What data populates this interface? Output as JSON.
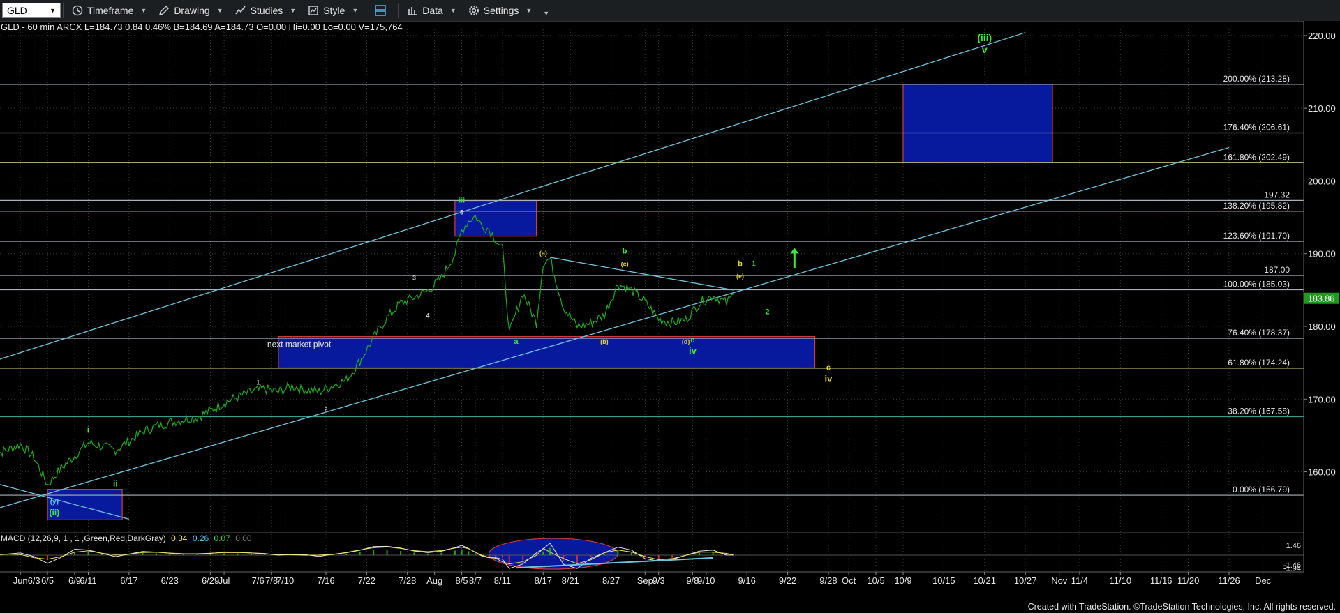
{
  "toolbar": {
    "symbol": "GLD",
    "timeframe": "Timeframe",
    "drawing": "Drawing",
    "studies": "Studies",
    "style": "Style",
    "data": "Data",
    "settings": "Settings"
  },
  "status_line": "GLD - 60 min  ARCX  L=184.73  0.84  0.46%  B=184.69  A=184.73  O=0.00  Hi=0.00  Lo=0.00  V=175,764",
  "macd_legend": {
    "name": "MACD (12,26,9, 1 , 1 ,Green,Red,DarkGray)",
    "v1": "0.34",
    "v2": "0.26",
    "v3": "0.07",
    "v4": "0.00",
    "c1": "#f0e060",
    "c2": "#5ec8ff",
    "c3": "#33dd44",
    "c4": "#777777"
  },
  "footer": "Created with TradeStation. ©TradeStation Technologies, Inc. All rights reserved.",
  "colors": {
    "background": "#000000",
    "grid": "#3a3a3a",
    "price": "#1faa1f",
    "channel": "#6fc4dc",
    "fib_line": "#a9b2bc",
    "box_fill": "#071a9e",
    "box_border": "#d23a3a",
    "wave_green": "#3ee83e",
    "wave_yellow": "#e2cf3a",
    "last_price": "#1f9a1f"
  },
  "chart_data": {
    "type": "line",
    "ylim": [
      152,
      222
    ],
    "y_ticks": [
      160,
      170,
      180,
      190,
      200,
      210,
      220
    ],
    "y_tick_labels": [
      "160.00",
      "170.00",
      "180.00",
      "190.00",
      "200.00",
      "210.00",
      "220.00"
    ],
    "x_tick_labels": [
      "Jun",
      "6/3",
      "6/5",
      "6/9",
      "6/11",
      "6/17",
      "6/23",
      "6/29",
      "Jul",
      "7/6",
      "7/8",
      "7/10",
      "7/16",
      "7/22",
      "7/28",
      "Aug",
      "8/5",
      "8/7",
      "8/11",
      "8/17",
      "8/21",
      "8/27",
      "Sep",
      "9/3",
      "9/8",
      "9/10",
      "9/16",
      "9/22",
      "9/28",
      "Oct",
      "10/5",
      "10/9",
      "10/15",
      "10/21",
      "10/27",
      "Nov",
      "11/4",
      "11/10",
      "11/16",
      "11/20",
      "11/26",
      "Dec"
    ],
    "x_tick_dates": [
      "2024-06-01",
      "2024-06-03",
      "2024-06-05",
      "2024-06-09",
      "2024-06-11",
      "2024-06-17",
      "2024-06-23",
      "2024-06-29",
      "2024-07-01",
      "2024-07-06",
      "2024-07-08",
      "2024-07-10",
      "2024-07-16",
      "2024-07-22",
      "2024-07-28",
      "2024-08-01",
      "2024-08-05",
      "2024-08-07",
      "2024-08-11",
      "2024-08-17",
      "2024-08-21",
      "2024-08-27",
      "2024-09-01",
      "2024-09-03",
      "2024-09-08",
      "2024-09-10",
      "2024-09-16",
      "2024-09-22",
      "2024-09-28",
      "2024-10-01",
      "2024-10-05",
      "2024-10-09",
      "2024-10-15",
      "2024-10-21",
      "2024-10-27",
      "2024-11-01",
      "2024-11-04",
      "2024-11-10",
      "2024-11-16",
      "2024-11-20",
      "2024-11-26",
      "2024-12-01"
    ],
    "last_price": "183.86",
    "last_value": 183.86,
    "price_series": {
      "x": [
        "2024-05-28",
        "2024-05-30",
        "2024-06-01",
        "2024-06-03",
        "2024-06-05",
        "2024-06-07",
        "2024-06-09",
        "2024-06-11",
        "2024-06-13",
        "2024-06-15",
        "2024-06-17",
        "2024-06-19",
        "2024-06-21",
        "2024-06-23",
        "2024-06-25",
        "2024-06-27",
        "2024-06-29",
        "2024-07-01",
        "2024-07-03",
        "2024-07-05",
        "2024-07-07",
        "2024-07-09",
        "2024-07-11",
        "2024-07-13",
        "2024-07-15",
        "2024-07-17",
        "2024-07-19",
        "2024-07-21",
        "2024-07-23",
        "2024-07-25",
        "2024-07-27",
        "2024-07-29",
        "2024-07-31",
        "2024-08-02",
        "2024-08-04",
        "2024-08-05",
        "2024-08-06",
        "2024-08-07",
        "2024-08-08",
        "2024-08-09",
        "2024-08-10",
        "2024-08-11",
        "2024-08-12",
        "2024-08-14",
        "2024-08-16",
        "2024-08-17",
        "2024-08-18",
        "2024-08-20",
        "2024-08-22",
        "2024-08-24",
        "2024-08-26",
        "2024-08-28",
        "2024-08-30",
        "2024-09-01",
        "2024-09-03",
        "2024-09-05",
        "2024-09-07",
        "2024-09-09",
        "2024-09-11",
        "2024-09-13",
        "2024-09-14"
      ],
      "y": [
        162.3,
        163.0,
        163.8,
        162.0,
        158.2,
        160.5,
        162.2,
        164.0,
        163.5,
        163.0,
        164.2,
        165.5,
        166.3,
        166.8,
        167.2,
        167.5,
        168.4,
        169.5,
        170.3,
        171.0,
        171.4,
        171.0,
        171.8,
        171.3,
        171.0,
        171.9,
        172.6,
        175.2,
        178.4,
        181.2,
        183.2,
        184.0,
        184.9,
        186.6,
        190.0,
        193.2,
        194.5,
        195.2,
        193.8,
        193.4,
        192.0,
        190.6,
        179.0,
        184.6,
        180.5,
        188.8,
        189.3,
        182.6,
        180.0,
        180.4,
        181.6,
        185.8,
        185.0,
        183.4,
        181.0,
        180.5,
        180.9,
        183.2,
        184.3,
        183.2,
        184.4
      ]
    },
    "fib_levels": [
      {
        "label": "200.00% (213.28)",
        "value": 213.28,
        "color": "#a9b2bc"
      },
      {
        "label": "176.40% (206.61)",
        "value": 206.61,
        "color": "#a9b2bc"
      },
      {
        "label": "161.80% (202.49)",
        "value": 202.49,
        "color": "#a8a66a"
      },
      {
        "label": "138.20% (195.82)",
        "value": 195.82,
        "color": "#3d9a8e"
      },
      {
        "label": "123.60% (191.70)",
        "value": 191.7,
        "color": "#a9b2bc"
      },
      {
        "label": "100.00% (185.03)",
        "value": 185.03,
        "color": "#a9b2bc"
      },
      {
        "label": "76.40% (178.37)",
        "value": 178.37,
        "color": "#a9b2bc"
      },
      {
        "label": "61.80% (174.24)",
        "value": 174.24,
        "color": "#a8a66a"
      },
      {
        "label": "38.20% (167.58)",
        "value": 167.58,
        "color": "#3d9a8e"
      },
      {
        "label": "0.00% (156.79)",
        "value": 156.79,
        "color": "#a9b2bc"
      }
    ],
    "extra_levels": [
      {
        "label": "197.32",
        "value": 197.32
      },
      {
        "label": "187.00",
        "value": 187.0
      }
    ],
    "boxes": [
      {
        "x0": "2024-10-09",
        "x1": "2024-10-31",
        "y0": 202.49,
        "y1": 213.28
      },
      {
        "x0": "2024-08-04",
        "x1": "2024-08-16",
        "y0": 192.4,
        "y1": 197.3
      },
      {
        "x0": "2024-07-09",
        "x1": "2024-09-26",
        "y0": 174.3,
        "y1": 178.6,
        "label": "next market pivot"
      },
      {
        "x0": "2024-06-05",
        "x1": "2024-06-16",
        "y0": 153.4,
        "y1": 157.6
      }
    ],
    "trend_lines": [
      {
        "x0": "2024-05-28",
        "y0": 175.2,
        "x1": "2024-10-27",
        "y1": 220.4
      },
      {
        "x0": "2024-05-28",
        "y0": 154.8,
        "x1": "2024-11-26",
        "y1": 204.6
      },
      {
        "x0": "2024-05-28",
        "y0": 158.5,
        "x1": "2024-06-17",
        "y1": 153.5
      },
      {
        "x0": "2024-08-18",
        "y0": 189.5,
        "x1": "2024-09-14",
        "y1": 185.0
      }
    ],
    "annotations": [
      {
        "text": "(iii)",
        "x": "2024-10-21",
        "y": 219.2,
        "color": "#3ee83e",
        "size": 14
      },
      {
        "text": "v",
        "x": "2024-10-21",
        "y": 217.6,
        "color": "#3ee83e",
        "size": 14
      },
      {
        "text": "iii",
        "x": "2024-08-05",
        "y": 197.0,
        "color": "#3ee83e",
        "size": 11
      },
      {
        "text": "5",
        "x": "2024-08-05",
        "y": 195.4,
        "color": "#cccccc",
        "size": 9
      },
      {
        "text": "3",
        "x": "2024-07-29",
        "y": 186.4,
        "color": "#cccccc",
        "size": 9
      },
      {
        "text": "4",
        "x": "2024-07-31",
        "y": 181.2,
        "color": "#cccccc",
        "size": 9
      },
      {
        "text": "1",
        "x": "2024-07-06",
        "y": 172.0,
        "color": "#cccccc",
        "size": 9
      },
      {
        "text": "2",
        "x": "2024-07-16",
        "y": 168.3,
        "color": "#cccccc",
        "size": 9
      },
      {
        "text": "i",
        "x": "2024-06-11",
        "y": 165.4,
        "color": "#3ee83e",
        "size": 12
      },
      {
        "text": "ii",
        "x": "2024-06-15",
        "y": 158.0,
        "color": "#3ee83e",
        "size": 12
      },
      {
        "text": "(y)",
        "x": "2024-06-06",
        "y": 155.6,
        "color": "#5ec8ff",
        "size": 10
      },
      {
        "text": "(ii)",
        "x": "2024-06-06",
        "y": 154.0,
        "color": "#3ee83e",
        "size": 12
      },
      {
        "text": "(a)",
        "x": "2024-08-17",
        "y": 189.8,
        "color": "#e2cf3a",
        "size": 9
      },
      {
        "text": "a",
        "x": "2024-08-13",
        "y": 177.6,
        "color": "#3ee83e",
        "size": 11
      },
      {
        "text": "b",
        "x": "2024-08-29",
        "y": 190.0,
        "color": "#3ee83e",
        "size": 11
      },
      {
        "text": "(c)",
        "x": "2024-08-29",
        "y": 188.3,
        "color": "#e2cf3a",
        "size": 9
      },
      {
        "text": "(b)",
        "x": "2024-08-26",
        "y": 177.6,
        "color": "#e2cf3a",
        "size": 9
      },
      {
        "text": "(d)",
        "x": "2024-09-07",
        "y": 177.6,
        "color": "#e2cf3a",
        "size": 9
      },
      {
        "text": "c",
        "x": "2024-09-08",
        "y": 177.8,
        "color": "#3ee83e",
        "size": 11
      },
      {
        "text": "iv",
        "x": "2024-09-08",
        "y": 176.2,
        "color": "#3ee83e",
        "size": 13
      },
      {
        "text": "b",
        "x": "2024-09-15",
        "y": 188.3,
        "color": "#e2cf3a",
        "size": 11
      },
      {
        "text": "1",
        "x": "2024-09-17",
        "y": 188.3,
        "color": "#3ee83e",
        "size": 11
      },
      {
        "text": "(e)",
        "x": "2024-09-15",
        "y": 186.6,
        "color": "#e2cf3a",
        "size": 9
      },
      {
        "text": "2",
        "x": "2024-09-19",
        "y": 181.7,
        "color": "#3ee83e",
        "size": 11
      },
      {
        "text": "c",
        "x": "2024-09-28",
        "y": 174.0,
        "color": "#e2cf3a",
        "size": 11
      },
      {
        "text": "iv",
        "x": "2024-09-28",
        "y": 172.4,
        "color": "#e2cf3a",
        "size": 13
      }
    ],
    "up_arrow": {
      "x": "2024-09-23",
      "y0": 188.0,
      "y1": 190.8
    },
    "macd": {
      "ylim": [
        -2.5,
        2.5
      ],
      "labels": [
        "1.46",
        "-1.46",
        "-1.94"
      ],
      "label_values": [
        1.46,
        -1.46,
        -1.94
      ],
      "last_value": "0.07",
      "highlight": {
        "x0": "2024-08-09",
        "x1": "2024-08-28"
      },
      "trend": {
        "x0": "2024-08-13",
        "y0": -1.9,
        "x1": "2024-09-11",
        "y1": -0.4
      }
    }
  }
}
